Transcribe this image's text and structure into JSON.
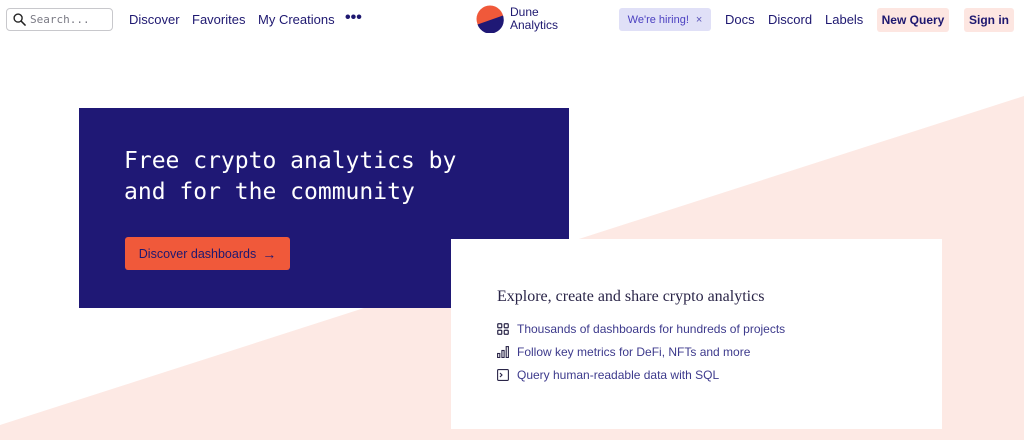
{
  "nav": {
    "search_placeholder": "Search...",
    "links": [
      "Discover",
      "Favorites",
      "My Creations"
    ],
    "more_label": "•••",
    "logo_line1": "Dune",
    "logo_line2": "Analytics",
    "hiring_label": "We're hiring!",
    "hiring_close": "×",
    "right_links": [
      "Docs",
      "Discord",
      "Labels"
    ],
    "new_query_label": "New Query",
    "sign_in_label": "Sign in"
  },
  "hero": {
    "title_line1": "Free crypto analytics by",
    "title_line2": "and for the community",
    "cta_label": "Discover dashboards",
    "cta_arrow": "→"
  },
  "card": {
    "heading": "Explore, create and share crypto analytics",
    "features": [
      {
        "icon": "grid-icon",
        "text": "Thousands of dashboards for hundreds of projects"
      },
      {
        "icon": "bar-chart-icon",
        "text": "Follow key metrics for DeFi, NFTs and more"
      },
      {
        "icon": "terminal-icon",
        "text": "Query human-readable data with SQL"
      }
    ]
  },
  "colors": {
    "navy": "#1f1875",
    "orange": "#f0593a",
    "pink": "#fde6e1",
    "hiring_bg": "#e0e0f7"
  }
}
